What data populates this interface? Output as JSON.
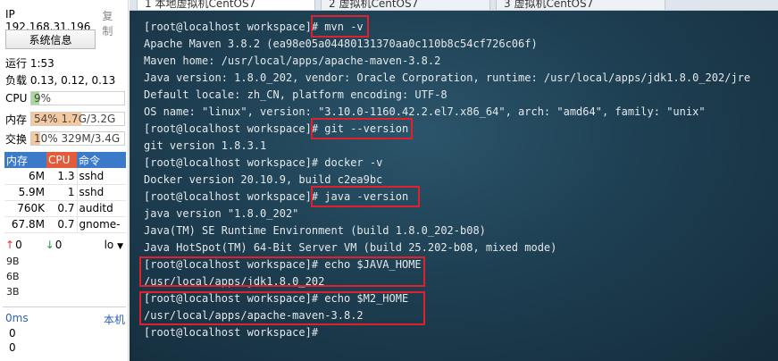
{
  "sidebar": {
    "ip_label": "IP 192.168.31.196",
    "copy_label": "复制",
    "sysinfo_button": "系统信息",
    "uptime": "运行 1:53",
    "load": "负载 0.13, 0.12, 0.13",
    "cpu": {
      "label": "CPU",
      "text": "9%",
      "percent": 9,
      "color": "#a9d99a"
    },
    "mem": {
      "label": "内存",
      "text": "54%   1.7G/3.2G",
      "percent": 54,
      "color": "#f5c9a0"
    },
    "swap": {
      "label": "交换",
      "text": "10%  329M/3.4G",
      "percent": 10,
      "color": "#f5c9a0"
    },
    "proc_headers": {
      "mem": "内存",
      "cpu": "CPU",
      "cmd": "命令"
    },
    "processes": [
      {
        "mem": "6M",
        "cpu": "1.3",
        "cmd": "sshd"
      },
      {
        "mem": "5.9M",
        "cpu": "1",
        "cmd": "sshd"
      },
      {
        "mem": "760K",
        "cpu": "0.7",
        "cmd": "auditd"
      },
      {
        "mem": "67.8M",
        "cpu": "0.7",
        "cmd": "gnome-"
      }
    ],
    "net": {
      "up_arrow": "↑",
      "up_value": "0",
      "down_arrow": "↓",
      "down_value": "0",
      "iface": "lo"
    },
    "net_scale": [
      "9B",
      "6B",
      "3B"
    ],
    "latency": {
      "label": "0ms",
      "host": "本机"
    },
    "latency_values": [
      "0",
      "0"
    ]
  },
  "tabs": [
    {
      "label": "1 本地虚拟机CentOS7"
    },
    {
      "label": "2 虚拟机CentOS7"
    },
    {
      "label": "3 虚拟机CentOS7"
    }
  ],
  "terminal": {
    "lines": [
      "[root@localhost workspace]# mvn -v",
      "Apache Maven 3.8.2 (ea98e05a04480131370aa0c110b8c54cf726c06f)",
      "Maven home: /usr/local/apps/apache-maven-3.8.2",
      "Java version: 1.8.0_202, vendor: Oracle Corporation, runtime: /usr/local/apps/jdk1.8.0_202/jre",
      "Default locale: zh_CN, platform encoding: UTF-8",
      "OS name: \"linux\", version: \"3.10.0-1160.42.2.el7.x86_64\", arch: \"amd64\", family: \"unix\"",
      "[root@localhost workspace]# git --version",
      "git version 1.8.3.1",
      "[root@localhost workspace]# docker -v",
      "Docker version 20.10.9, build c2ea9bc",
      "[root@localhost workspace]# java -version",
      "java version \"1.8.0_202\"",
      "Java(TM) SE Runtime Environment (build 1.8.0_202-b08)",
      "Java HotSpot(TM) 64-Bit Server VM (build 25.202-b08, mixed mode)",
      "[root@localhost workspace]# echo $JAVA_HOME",
      "/usr/local/apps/jdk1.8.0_202",
      "[root@localhost workspace]# echo $M2_HOME",
      "/usr/local/apps/apache-maven-3.8.2",
      "[root@localhost workspace]# "
    ]
  },
  "colors": {
    "highlight": "#e0202a",
    "cpu_header": "#e25b3b",
    "mem_header": "#3a7ac9"
  }
}
